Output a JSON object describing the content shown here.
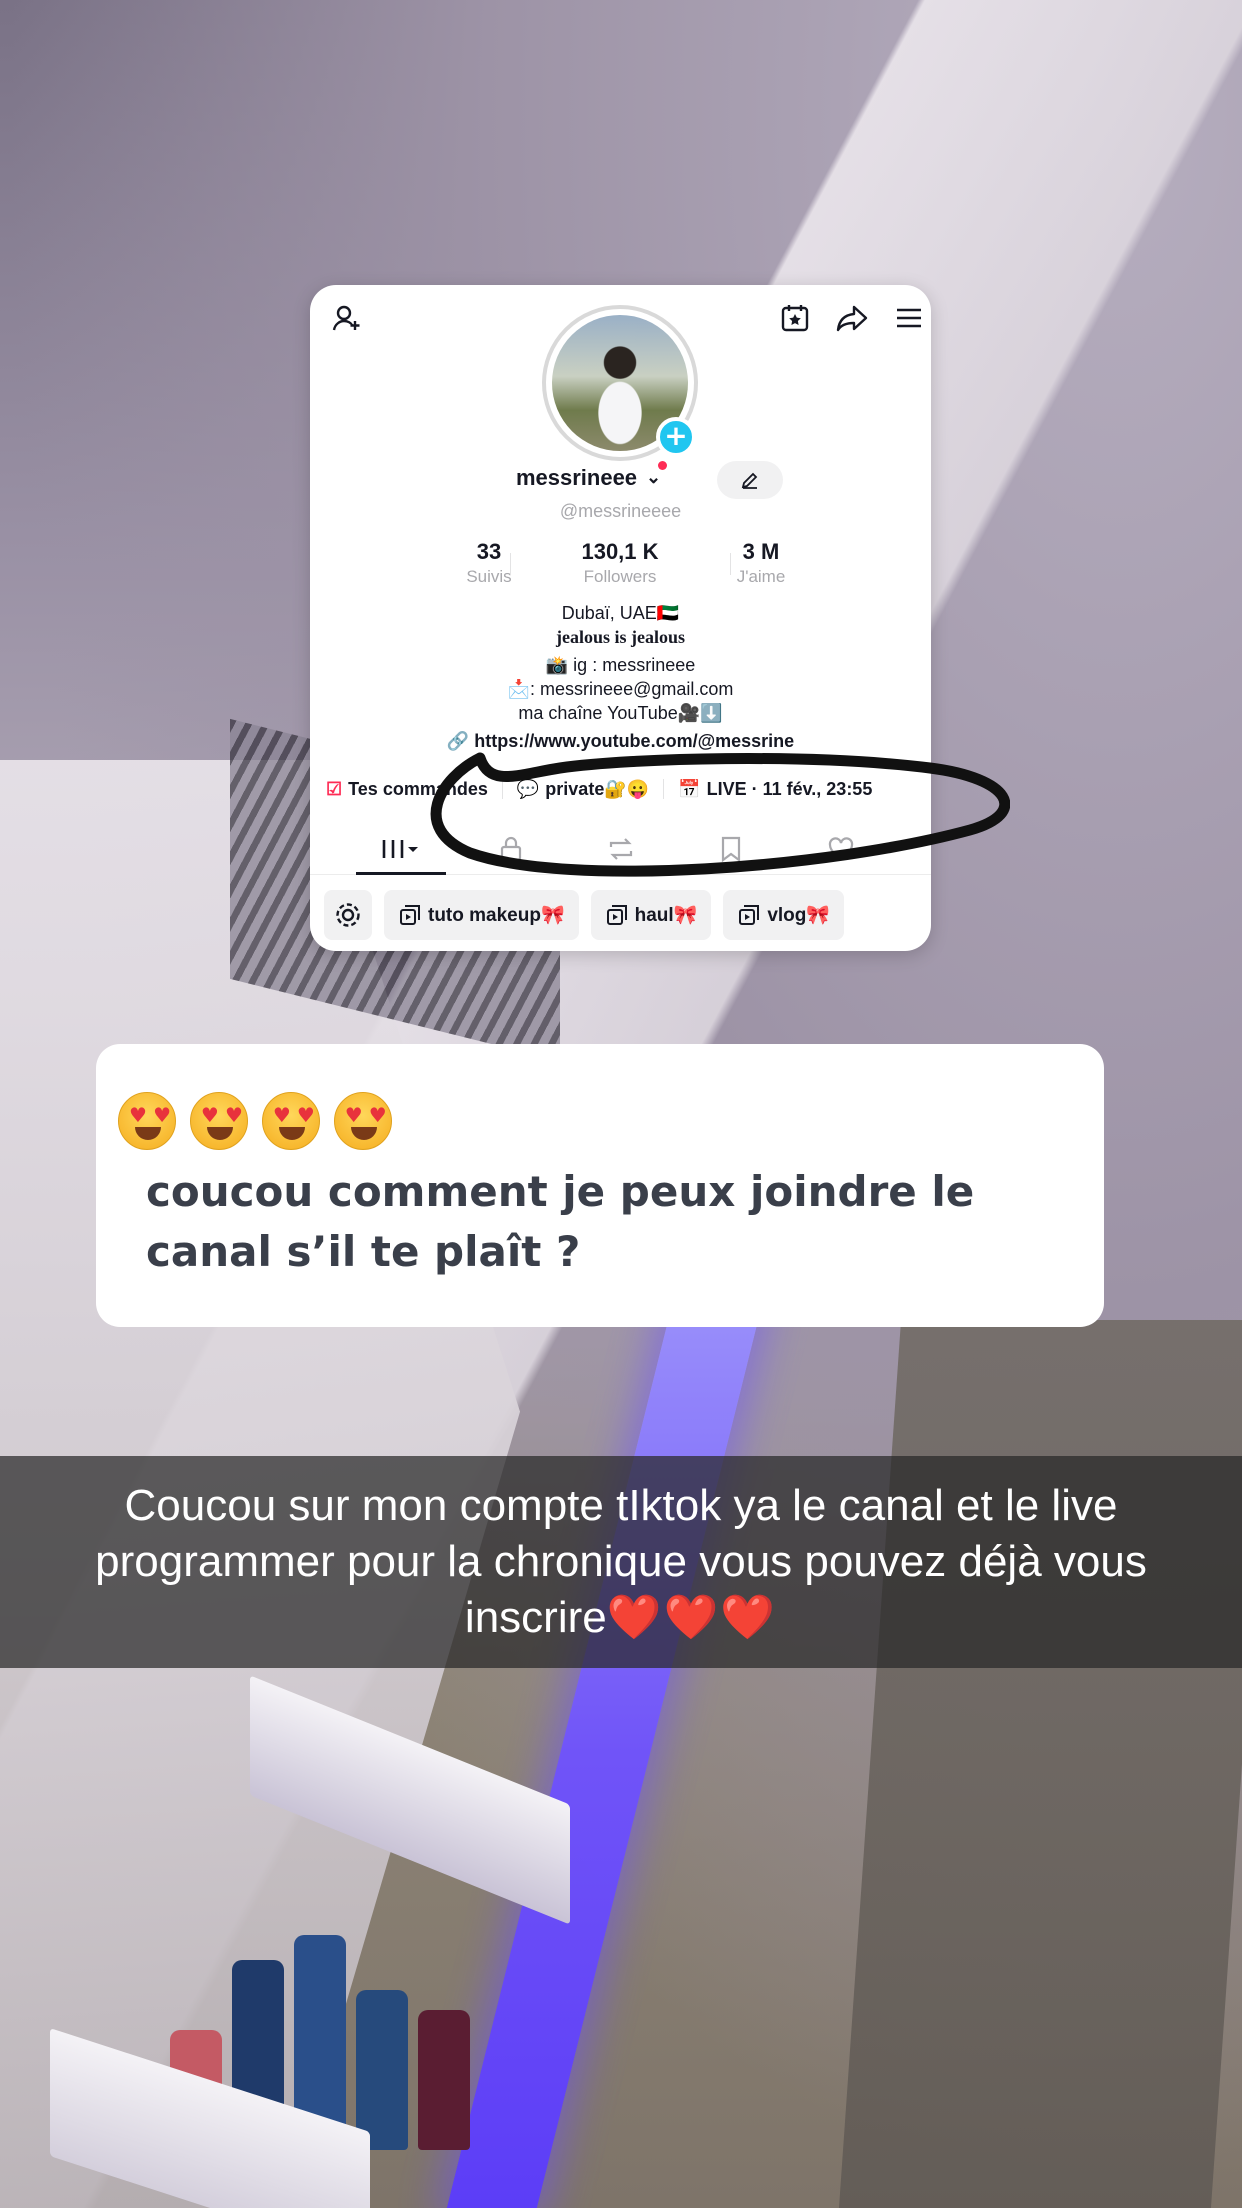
{
  "profile": {
    "username": "messrineee",
    "handle": "@messrineeee",
    "stats": [
      {
        "value": "33",
        "label": "Suivis"
      },
      {
        "value": "130,1 K",
        "label": "Followers"
      },
      {
        "value": "3 M",
        "label": "J'aime"
      }
    ],
    "bio": {
      "location": "Dubaï, UAE🇦🇪",
      "tagline": "jealous is jealous",
      "ig": "📸 ig : messrineee",
      "email": "📩: messrineee@gmail.com",
      "youtube": "ma chaîne YouTube🎥⬇️",
      "link": "https://www.youtube.com/@messrine"
    },
    "pills": [
      {
        "label": "Tes commandes",
        "icon": "orders-icon"
      },
      {
        "label": "private🔐😛",
        "icon": "chat-icon"
      },
      {
        "label": "LIVE · 11 fév., 23:55",
        "icon": "live-calendar-icon"
      }
    ],
    "chips": [
      {
        "label": "tuto makeup🎀"
      },
      {
        "label": "haul🎀"
      },
      {
        "label": "vlog🎀"
      }
    ]
  },
  "question": {
    "prompt": "coucou comment je peux joindre le canal s’il te plaît ?"
  },
  "caption": {
    "text": "Coucou sur mon compte tIktok ya le canal et le live programmer pour la chronique vous pouvez déjà vous inscrire",
    "hearts": "❤️❤️❤️"
  },
  "colors": {
    "accent_red": "#fe2c55",
    "accent_cyan": "#20c6f0",
    "caption_bg": "#282828",
    "marker": "#111111"
  }
}
